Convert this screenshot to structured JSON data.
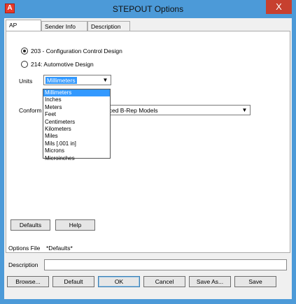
{
  "window": {
    "title": "STEPOUT Options",
    "app_icon": "A",
    "close_glyph": "X"
  },
  "tabs": [
    {
      "label": "AP"
    },
    {
      "label": "Sender Info"
    },
    {
      "label": "Description"
    }
  ],
  "ap": {
    "option1_label": "203 - Configuration Control Design",
    "option2_label": "214: Automotive Design",
    "units_label": "Units",
    "units_value": "Millimeters",
    "conformance_label": "Conform",
    "conformance_value": "nced B-Rep Models",
    "dropdown_items": [
      "Millimeters",
      "Inches",
      "Meters",
      "Feet",
      "Centimeters",
      "Kilometers",
      "Miles",
      "Mils [.001 in]",
      "Microns",
      "Microinches"
    ]
  },
  "panel_buttons": {
    "defaults": "Defaults",
    "help": "Help"
  },
  "footer": {
    "options_file_label": "Options File",
    "options_file_value": "*Defaults*",
    "description_label": "Description",
    "description_value": ""
  },
  "buttons": {
    "browse": "Browse...",
    "default": "Default",
    "ok": "OK",
    "cancel": "Cancel",
    "save_as": "Save As...",
    "save": "Save"
  },
  "colors": {
    "titlebar": "#4c9ad8",
    "close": "#c7402f",
    "selection": "#3399ff"
  }
}
